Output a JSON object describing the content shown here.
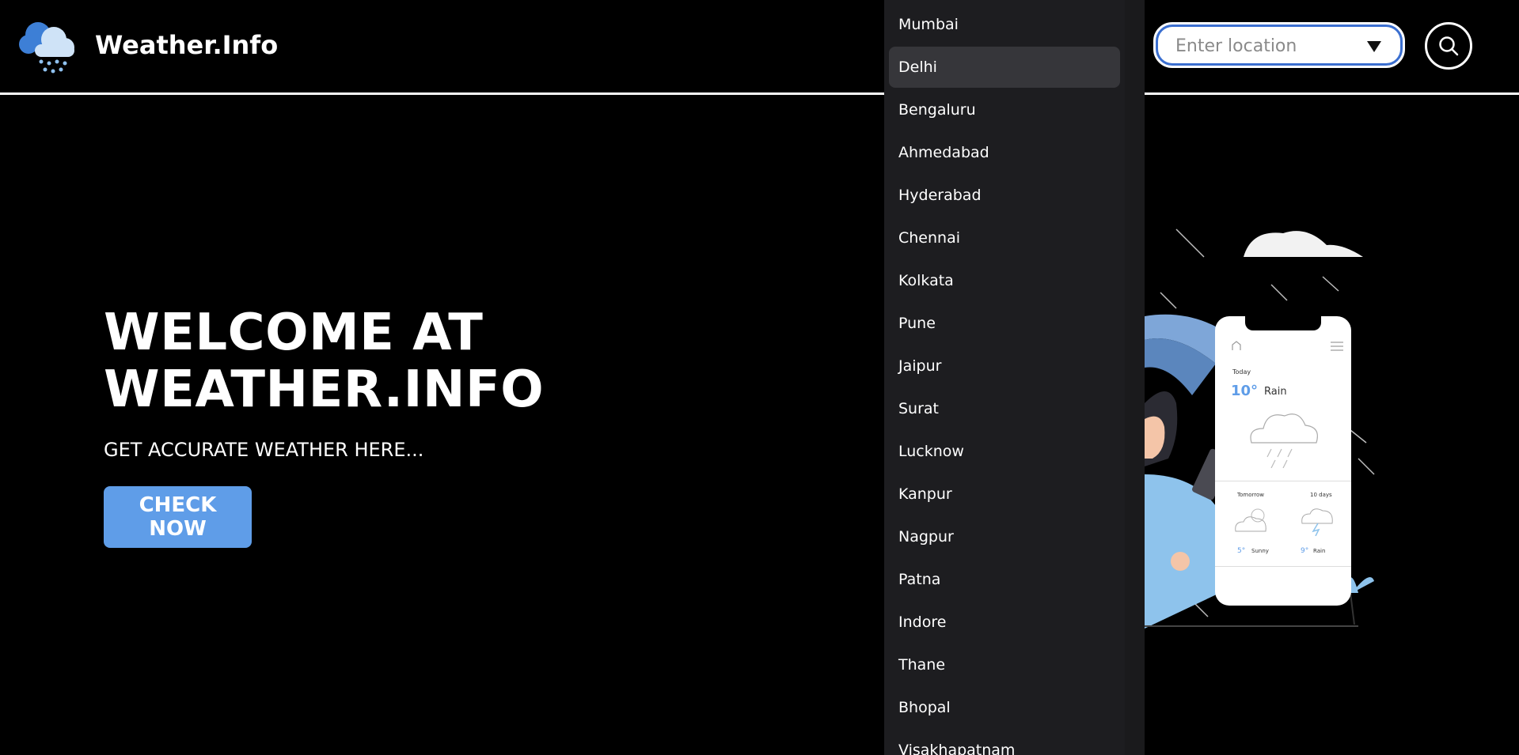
{
  "header": {
    "brand": "Weather.Info",
    "search_placeholder": "Enter location"
  },
  "dropdown": {
    "selected": "Delhi",
    "items": [
      "Mumbai",
      "Delhi",
      "Bengaluru",
      "Ahmedabad",
      "Hyderabad",
      "Chennai",
      "Kolkata",
      "Pune",
      "Jaipur",
      "Surat",
      "Lucknow",
      "Kanpur",
      "Nagpur",
      "Patna",
      "Indore",
      "Thane",
      "Bhopal",
      "Visakhapatnam"
    ]
  },
  "hero": {
    "title_line1": "WELCOME AT",
    "title_line2": "WEATHER.INFO",
    "subtitle": "GET ACCURATE WEATHER HERE...",
    "cta": "CHECK NOW"
  },
  "phone": {
    "today_label": "Today",
    "today_temp": "10°",
    "today_condition": "Rain",
    "tomorrow_label": "Tomorrow",
    "tomorrow_temp": "5°",
    "tomorrow_condition": "Sunny",
    "ten_days_label": "10 days",
    "ten_days_temp": "9°",
    "ten_days_condition": "Rain"
  },
  "colors": {
    "accent": "#5f9de8",
    "search_border": "#3b6fd0",
    "dropdown_bg": "#1d1d20",
    "selected_bg": "#36363a"
  }
}
